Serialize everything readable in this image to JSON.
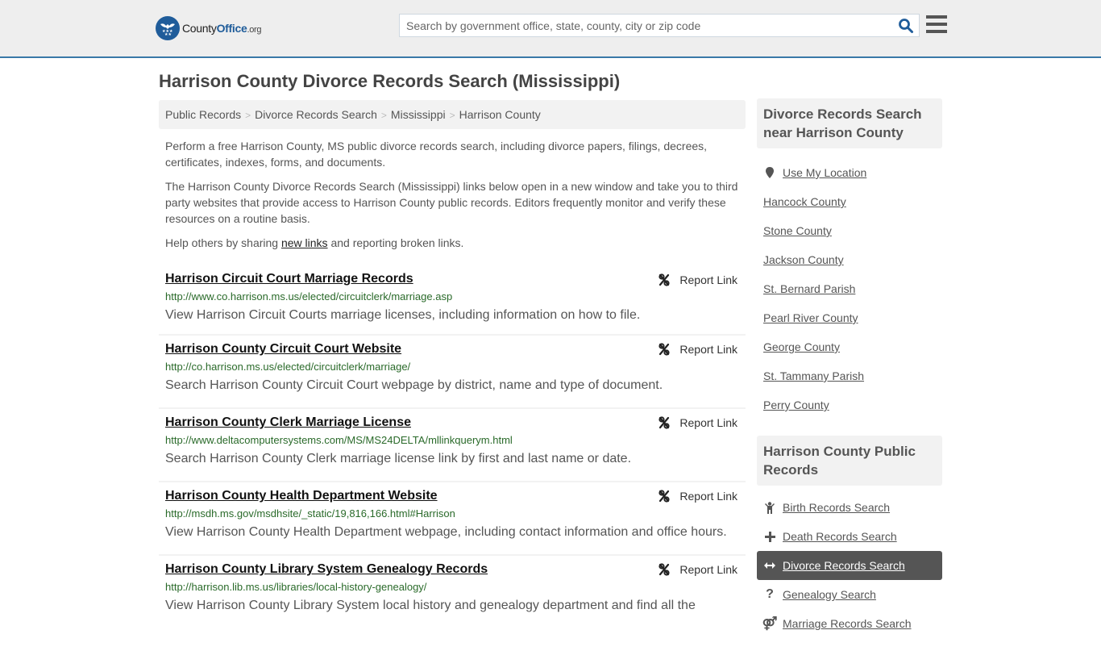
{
  "header": {
    "logo": {
      "brand_prefix": "County",
      "brand_main": "Office",
      "brand_suffix": ".org"
    },
    "search": {
      "placeholder": "Search by government office, state, county, city or zip code",
      "value": ""
    },
    "icons": {
      "search": "search-icon",
      "menu": "hamburger-menu-icon"
    }
  },
  "page": {
    "title": "Harrison County Divorce Records Search (Mississippi)"
  },
  "breadcrumb": [
    {
      "label": "Public Records"
    },
    {
      "label": "Divorce Records Search"
    },
    {
      "label": "Mississippi"
    },
    {
      "label": "Harrison County"
    }
  ],
  "breadcrumb_separator": ">",
  "intro": {
    "p1": "Perform a free Harrison County, MS public divorce records search, including divorce papers, filings, decrees, certificates, indexes, forms, and documents.",
    "p2": "The Harrison County Divorce Records Search (Mississippi) links below open in a new window and take you to third party websites that provide access to Harrison County public records. Editors frequently monitor and verify these resources on a routine basis.",
    "p3_before": "Help others by sharing ",
    "p3_link": "new links",
    "p3_after": " and reporting broken links."
  },
  "report_label": "Report Link",
  "results": [
    {
      "title": "Harrison Circuit Court Marriage Records",
      "url": "http://www.co.harrison.ms.us/elected/circuitclerk/marriage.asp",
      "description": "View Harrison Circuit Courts marriage licenses, including information on how to file."
    },
    {
      "title": "Harrison County Circuit Court Website",
      "url": "http://co.harrison.ms.us/elected/circuitclerk/marriage/",
      "description": "Search Harrison County Circuit Court webpage by district, name and type of document."
    },
    {
      "title": "Harrison County Clerk Marriage License",
      "url": "http://www.deltacomputersystems.com/MS/MS24DELTA/mllinkquerym.html",
      "description": "Search Harrison County Clerk marriage license link by first and last name or date."
    },
    {
      "title": "Harrison County Health Department Website",
      "url": "http://msdh.ms.gov/msdhsite/_static/19,816,166.html#Harrison",
      "description": "View Harrison County Health Department webpage, including contact information and office hours."
    },
    {
      "title": "Harrison County Library System Genealogy Records",
      "url": "http://harrison.lib.ms.us/libraries/local-history-genealogy/",
      "description": "View Harrison County Library System local history and genealogy department and find all the"
    }
  ],
  "sidebar": {
    "nearby": {
      "heading": "Divorce Records Search near Harrison County",
      "use_location": {
        "label": "Use My Location",
        "icon": "map-pin-icon"
      },
      "items": [
        {
          "label": "Hancock County"
        },
        {
          "label": "Stone County"
        },
        {
          "label": "Jackson County"
        },
        {
          "label": "St. Bernard Parish"
        },
        {
          "label": "Pearl River County"
        },
        {
          "label": "George County"
        },
        {
          "label": "St. Tammany Parish"
        },
        {
          "label": "Perry County"
        }
      ]
    },
    "public_records": {
      "heading": "Harrison County Public Records",
      "items": [
        {
          "label": "Birth Records Search",
          "icon": "baby-icon",
          "active": false
        },
        {
          "label": "Death Records Search",
          "icon": "cross-icon",
          "active": false
        },
        {
          "label": "Divorce Records Search",
          "icon": "arrows-left-right-icon",
          "active": true
        },
        {
          "label": "Genealogy Search",
          "icon": "question-icon",
          "active": false
        },
        {
          "label": "Marriage Records Search",
          "icon": "marriage-symbol-icon",
          "active": false
        }
      ]
    }
  },
  "colors": {
    "brand_blue": "#1f5c9a",
    "header_border": "#3a79a8",
    "url_green": "#2a6a2a",
    "active_item_bg": "#555555"
  }
}
